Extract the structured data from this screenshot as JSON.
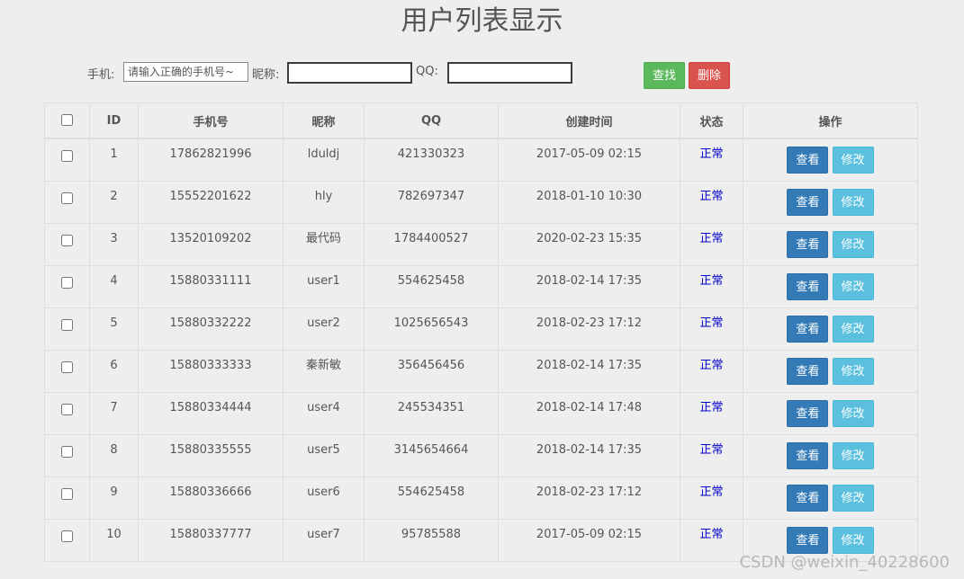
{
  "page": {
    "title": "用户列表显示",
    "watermark": "CSDN @weixin_40228600"
  },
  "search": {
    "phone_label": "手机:",
    "phone_placeholder": "请输入正确的手机号~",
    "nickname_label": "昵称:",
    "nickname_value": "",
    "qq_label": "QQ:",
    "qq_value": "",
    "search_button": "查找",
    "delete_button": "删除"
  },
  "table": {
    "headers": {
      "id": "ID",
      "phone": "手机号",
      "nickname": "昵称",
      "qq": "QQ",
      "created": "创建时间",
      "status": "状态",
      "actions": "操作"
    },
    "view_label": "查看",
    "edit_label": "修改",
    "rows": [
      {
        "id": "1",
        "phone": "17862821996",
        "nickname": "lduldj",
        "qq": "421330323",
        "created": "2017-05-09 02:15",
        "status": "正常"
      },
      {
        "id": "2",
        "phone": "15552201622",
        "nickname": "hly",
        "qq": "782697347",
        "created": "2018-01-10 10:30",
        "status": "正常"
      },
      {
        "id": "3",
        "phone": "13520109202",
        "nickname": "最代码",
        "qq": "1784400527",
        "created": "2020-02-23 15:35",
        "status": "正常"
      },
      {
        "id": "4",
        "phone": "15880331111",
        "nickname": "user1",
        "qq": "554625458",
        "created": "2018-02-14 17:35",
        "status": "正常"
      },
      {
        "id": "5",
        "phone": "15880332222",
        "nickname": "user2",
        "qq": "1025656543",
        "created": "2018-02-23 17:12",
        "status": "正常"
      },
      {
        "id": "6",
        "phone": "15880333333",
        "nickname": "秦新敏",
        "qq": "356456456",
        "created": "2018-02-14 17:35",
        "status": "正常"
      },
      {
        "id": "7",
        "phone": "15880334444",
        "nickname": "user4",
        "qq": "245534351",
        "created": "2018-02-14 17:48",
        "status": "正常"
      },
      {
        "id": "8",
        "phone": "15880335555",
        "nickname": "user5",
        "qq": "3145654664",
        "created": "2018-02-14 17:35",
        "status": "正常"
      },
      {
        "id": "9",
        "phone": "15880336666",
        "nickname": "user6",
        "qq": "554625458",
        "created": "2018-02-23 17:12",
        "status": "正常"
      },
      {
        "id": "10",
        "phone": "15880337777",
        "nickname": "user7",
        "qq": "95785588",
        "created": "2017-05-09 02:15",
        "status": "正常"
      }
    ]
  },
  "colors": {
    "background": "#eeeeee",
    "search_button": "#5cb85c",
    "delete_button": "#d9534f",
    "view_button": "#337ab7",
    "edit_button": "#5bc0de",
    "status_text": "#0000cc"
  }
}
